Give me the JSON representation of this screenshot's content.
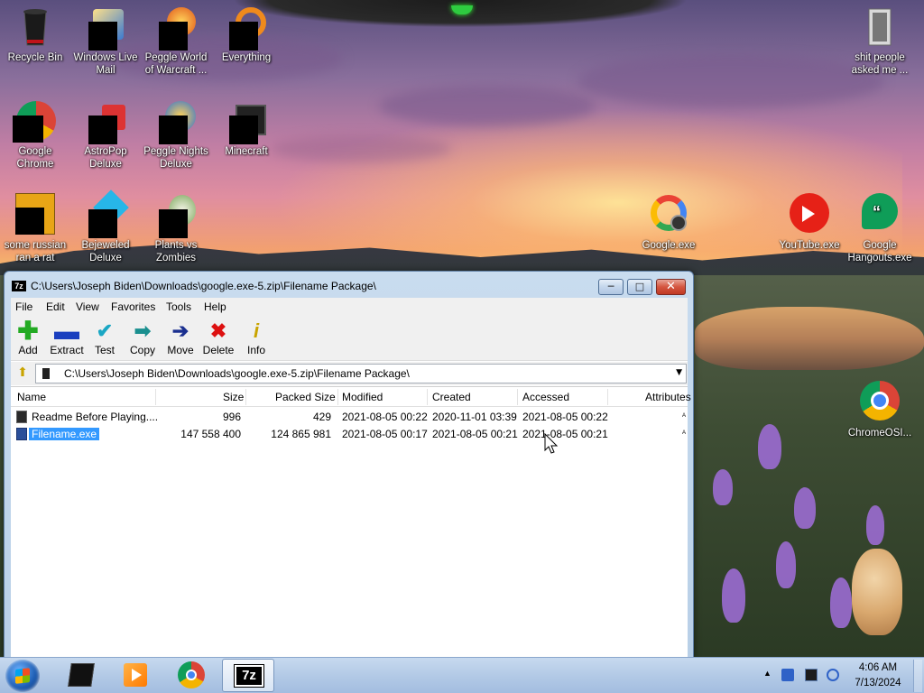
{
  "desktop": {
    "icons": [
      {
        "label": "Recycle Bin"
      },
      {
        "label": "Windows Live Mail"
      },
      {
        "label": "Peggle World of Warcraft ..."
      },
      {
        "label": "Everything"
      },
      {
        "label": "Google Chrome"
      },
      {
        "label": "AstroPop Deluxe"
      },
      {
        "label": "Peggle Nights Deluxe"
      },
      {
        "label": "Minecraft"
      },
      {
        "label": "some russian ran a rat"
      },
      {
        "label": "Bejeweled Deluxe"
      },
      {
        "label": "Plants vs Zombies"
      },
      {
        "label": "shit people asked me ..."
      },
      {
        "label": "Google.exe"
      },
      {
        "label": "YouTube.exe"
      },
      {
        "label": "Google Hangouts.exe"
      },
      {
        "label": "ChromeOSI..."
      }
    ]
  },
  "window": {
    "title": "C:\\Users\\Joseph Biden\\Downloads\\google.exe-5.zip\\Filename Package\\",
    "app_logo": "7z",
    "menu": [
      "File",
      "Edit",
      "View",
      "Favorites",
      "Tools",
      "Help"
    ],
    "toolbar": [
      {
        "label": "Add",
        "icon": "plus-icon",
        "color": "#22aa22"
      },
      {
        "label": "Extract",
        "icon": "minus-icon",
        "color": "#1a3fbf"
      },
      {
        "label": "Test",
        "icon": "check-icon",
        "color": "#1aa7c4"
      },
      {
        "label": "Copy",
        "icon": "double-arrow-icon",
        "color": "#1a8f8f"
      },
      {
        "label": "Move",
        "icon": "arrow-right-icon",
        "color": "#1a2f8f"
      },
      {
        "label": "Delete",
        "icon": "x-icon",
        "color": "#dd1111"
      },
      {
        "label": "Info",
        "icon": "info-icon",
        "color": "#c9a400"
      }
    ],
    "address": "C:\\Users\\Joseph Biden\\Downloads\\google.exe-5.zip\\Filename Package\\",
    "columns": [
      "Name",
      "Size",
      "Packed Size",
      "Modified",
      "Created",
      "Accessed",
      "Attributes"
    ],
    "rows": [
      {
        "name": "Readme Before Playing....",
        "size": "996",
        "packed": "429",
        "modified": "2021-08-05 00:22",
        "created": "2020-11-01 03:39",
        "accessed": "2021-08-05 00:22",
        "attributes": "A"
      },
      {
        "name": "Filename.exe",
        "size": "147 558 400",
        "packed": "124 865 981",
        "modified": "2021-08-05 00:17",
        "created": "2021-08-05 00:21",
        "accessed": "2021-08-05 00:21",
        "attributes": "A"
      }
    ]
  },
  "taskbar": {
    "time": "4:06 AM",
    "date": "7/13/2024",
    "apps": [
      "black-window-app",
      "media-player-app",
      "chrome-app",
      "7zip-app"
    ],
    "active_app_logo": "7z"
  },
  "colors": {
    "selection": "#3399ff",
    "close_button": "#c03a24"
  }
}
